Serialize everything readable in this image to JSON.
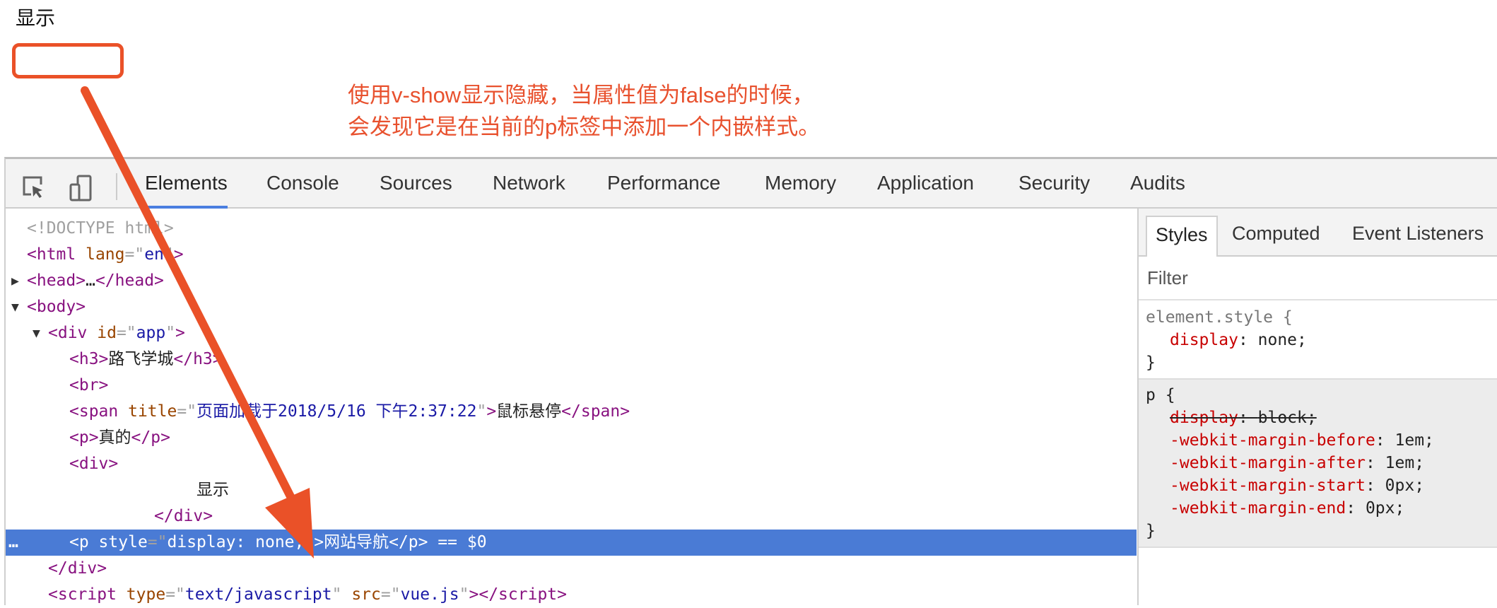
{
  "page": {
    "text": "显示"
  },
  "annotation": {
    "line1": "使用v-show显示隐藏，当属性值为false的时候，",
    "line2": "会发现它是在当前的p标签中添加一个内嵌样式。",
    "color": "#e8512e"
  },
  "devtools": {
    "tabs": [
      "Elements",
      "Console",
      "Sources",
      "Network",
      "Performance",
      "Memory",
      "Application",
      "Security",
      "Audits"
    ],
    "active_tab": "Elements",
    "icons": [
      "inspect-element-icon",
      "device-toolbar-icon"
    ],
    "dom_lines": [
      {
        "indent": 0,
        "tri": "",
        "tokens": [
          [
            "doct",
            "<!DOCTYPE html>"
          ]
        ]
      },
      {
        "indent": 0,
        "tri": "",
        "tokens": [
          [
            "tag",
            "<html"
          ],
          [
            "attr",
            " lang"
          ],
          [
            "punct",
            "=\""
          ],
          [
            "val",
            "en"
          ],
          [
            "punct",
            "\""
          ],
          [
            "tag",
            ">"
          ]
        ]
      },
      {
        "indent": 0,
        "tri": "▶",
        "tokens": [
          [
            "tag",
            "<head>"
          ],
          [
            "txt",
            "…"
          ],
          [
            "tag",
            "</head>"
          ]
        ]
      },
      {
        "indent": 0,
        "tri": "▼",
        "tokens": [
          [
            "tag",
            "<body>"
          ]
        ]
      },
      {
        "indent": 1,
        "tri": "▼",
        "tokens": [
          [
            "tag",
            "<div"
          ],
          [
            "attr",
            " id"
          ],
          [
            "punct",
            "=\""
          ],
          [
            "val",
            "app"
          ],
          [
            "punct",
            "\""
          ],
          [
            "tag",
            ">"
          ]
        ]
      },
      {
        "indent": 2,
        "tri": "",
        "tokens": [
          [
            "tag",
            "<h3>"
          ],
          [
            "txt",
            "路飞学城"
          ],
          [
            "tag",
            "</h3>"
          ]
        ]
      },
      {
        "indent": 2,
        "tri": "",
        "tokens": [
          [
            "tag",
            "<br>"
          ]
        ]
      },
      {
        "indent": 2,
        "tri": "",
        "tokens": [
          [
            "tag",
            "<span"
          ],
          [
            "attr",
            " title"
          ],
          [
            "punct",
            "=\""
          ],
          [
            "val",
            "页面加载于2018/5/16 下午2:37:22"
          ],
          [
            "punct",
            "\""
          ],
          [
            "tag",
            ">"
          ],
          [
            "txt",
            "鼠标悬停"
          ],
          [
            "tag",
            "</span>"
          ]
        ]
      },
      {
        "indent": 2,
        "tri": "",
        "tokens": [
          [
            "tag",
            "<p>"
          ],
          [
            "txt",
            "真的"
          ],
          [
            "tag",
            "</p>"
          ]
        ]
      },
      {
        "indent": 2,
        "tri": "",
        "tokens": [
          [
            "tag",
            "<div>"
          ]
        ]
      },
      {
        "indent": 8,
        "tri": "",
        "tokens": [
          [
            "txt",
            "显示"
          ]
        ]
      },
      {
        "indent": 6,
        "tri": "",
        "tokens": [
          [
            "tag",
            "</div>"
          ]
        ]
      },
      {
        "indent": 2,
        "tri": "",
        "selected": true,
        "tokens": [
          [
            "tag",
            "<p"
          ],
          [
            "attr",
            " style"
          ],
          [
            "punct",
            "=\""
          ],
          [
            "val",
            "display: none;"
          ],
          [
            "punct",
            "\""
          ],
          [
            "tag",
            ">"
          ],
          [
            "txt",
            "网站导航"
          ],
          [
            "tag",
            "</p>"
          ],
          [
            "eq",
            " == $0"
          ]
        ]
      },
      {
        "indent": 1,
        "tri": "",
        "tokens": [
          [
            "tag",
            "</div>"
          ]
        ]
      },
      {
        "indent": 1,
        "tri": "",
        "tokens": [
          [
            "tag",
            "<script"
          ],
          [
            "attr",
            " type"
          ],
          [
            "punct",
            "=\""
          ],
          [
            "val",
            "text/javascript"
          ],
          [
            "punct",
            "\""
          ],
          [
            "attr",
            " src"
          ],
          [
            "punct",
            "=\""
          ],
          [
            "val",
            "vue.js"
          ],
          [
            "punct",
            "\""
          ],
          [
            "tag",
            "></script>"
          ]
        ]
      }
    ],
    "selected_marker": "…",
    "sidebar": {
      "tabs": [
        "Styles",
        "Computed",
        "Event Listeners"
      ],
      "active_tab": "Styles",
      "filter_placeholder": "Filter",
      "rules": [
        {
          "selector": "element.style {",
          "props": [
            {
              "name": "display",
              "value": "none;",
              "struck": false
            }
          ],
          "close": "}"
        },
        {
          "selector": "p {",
          "props": [
            {
              "name": "display",
              "value": "block;",
              "struck": true
            },
            {
              "name": "-webkit-margin-before",
              "value": "1em;",
              "struck": false
            },
            {
              "name": "-webkit-margin-after",
              "value": "1em;",
              "struck": false
            },
            {
              "name": "-webkit-margin-start",
              "value": "0px;",
              "struck": false
            },
            {
              "name": "-webkit-margin-end",
              "value": "0px;",
              "struck": false
            }
          ],
          "close": "}"
        }
      ]
    }
  }
}
